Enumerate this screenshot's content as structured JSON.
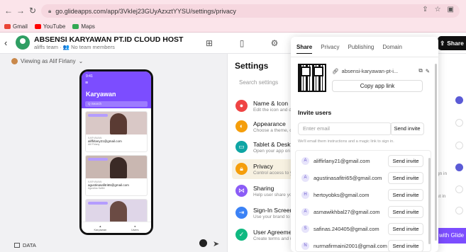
{
  "browser": {
    "url": "go.glideapps.com/app/3VkIej23GUyAzxztYYSU/settings/privacy",
    "bookmarks": [
      "Gmail",
      "YouTube",
      "Maps"
    ]
  },
  "app": {
    "title": "ABSENSI KARYAWAN PT.ID CLOUD HOST",
    "subtitle": "aliffs team · 👥 No team members",
    "share_label": "Share"
  },
  "preview": {
    "viewing_as": "Viewing as Alif Firlany",
    "phone_title": "Karyawan",
    "phone_search": "Q Search",
    "nav_left": "Karyawan",
    "nav_right": "Users",
    "data_label": "DATA",
    "cards": [
      {
        "t1": "KARYAWAN",
        "t2": "aliffirlany21@gmail.com",
        "t3": "Alif Firlany"
      },
      {
        "t1": "KARYAWAN",
        "t2": "agustinasafitri65@gmail.com",
        "t3": "Agustina Safitri"
      },
      {
        "t1": "KARYAWAN",
        "t2": "",
        "t3": ""
      }
    ]
  },
  "settings": {
    "title": "Settings",
    "search_placeholder": "Search settings",
    "items": [
      {
        "label": "Name & Icon",
        "desc": "Edit the icon and d"
      },
      {
        "label": "Appearance",
        "desc": "Choose a theme, c"
      },
      {
        "label": "Tablet & Deskto",
        "desc": "Open your app on"
      },
      {
        "label": "Privacy",
        "desc": "Control access to y"
      },
      {
        "label": "Sharing",
        "desc": "Help user share yo"
      },
      {
        "label": "Sign-In Screen",
        "desc": "Use your brand to"
      },
      {
        "label": "User Agreement",
        "desc": "Create terms and u"
      }
    ],
    "colors": [
      "#ef4444",
      "#f59e0b",
      "#0ea5a4",
      "#f59e0b",
      "#8b5cf6",
      "#3b82f6",
      "#10b981"
    ]
  },
  "right_strip": {
    "text_1": "gn in",
    "text_2": "ut in",
    "glide_label": "with Glide"
  },
  "share_popover": {
    "tabs": [
      "Share",
      "Privacy",
      "Publishing",
      "Domain"
    ],
    "link_text": "absensi-karyawan-pt-i...",
    "copy_label": "Copy app link",
    "invite_title": "Invite users",
    "email_placeholder": "Enter email",
    "send_invite_label": "Send invite",
    "note": "We'll email them instructions and a magic link to sign in.",
    "invitees": [
      {
        "initial": "A",
        "email": "aliffirlany21@gmail.com",
        "action": "Send invite"
      },
      {
        "initial": "A",
        "email": "agustinasafitri65@gmail.com",
        "action": "Send invite"
      },
      {
        "initial": "H",
        "email": "hertoyobks@gmail.com",
        "action": "Send invite"
      },
      {
        "initial": "A",
        "email": "asmawikhbal27@gmail.com",
        "action": "Send invite"
      },
      {
        "initial": "S",
        "email": "safinas.240405@gmail.com",
        "action": "Send invite"
      },
      {
        "initial": "N",
        "email": "nurmafirmaini2001@gmail.com",
        "action": "Send invite"
      }
    ]
  }
}
